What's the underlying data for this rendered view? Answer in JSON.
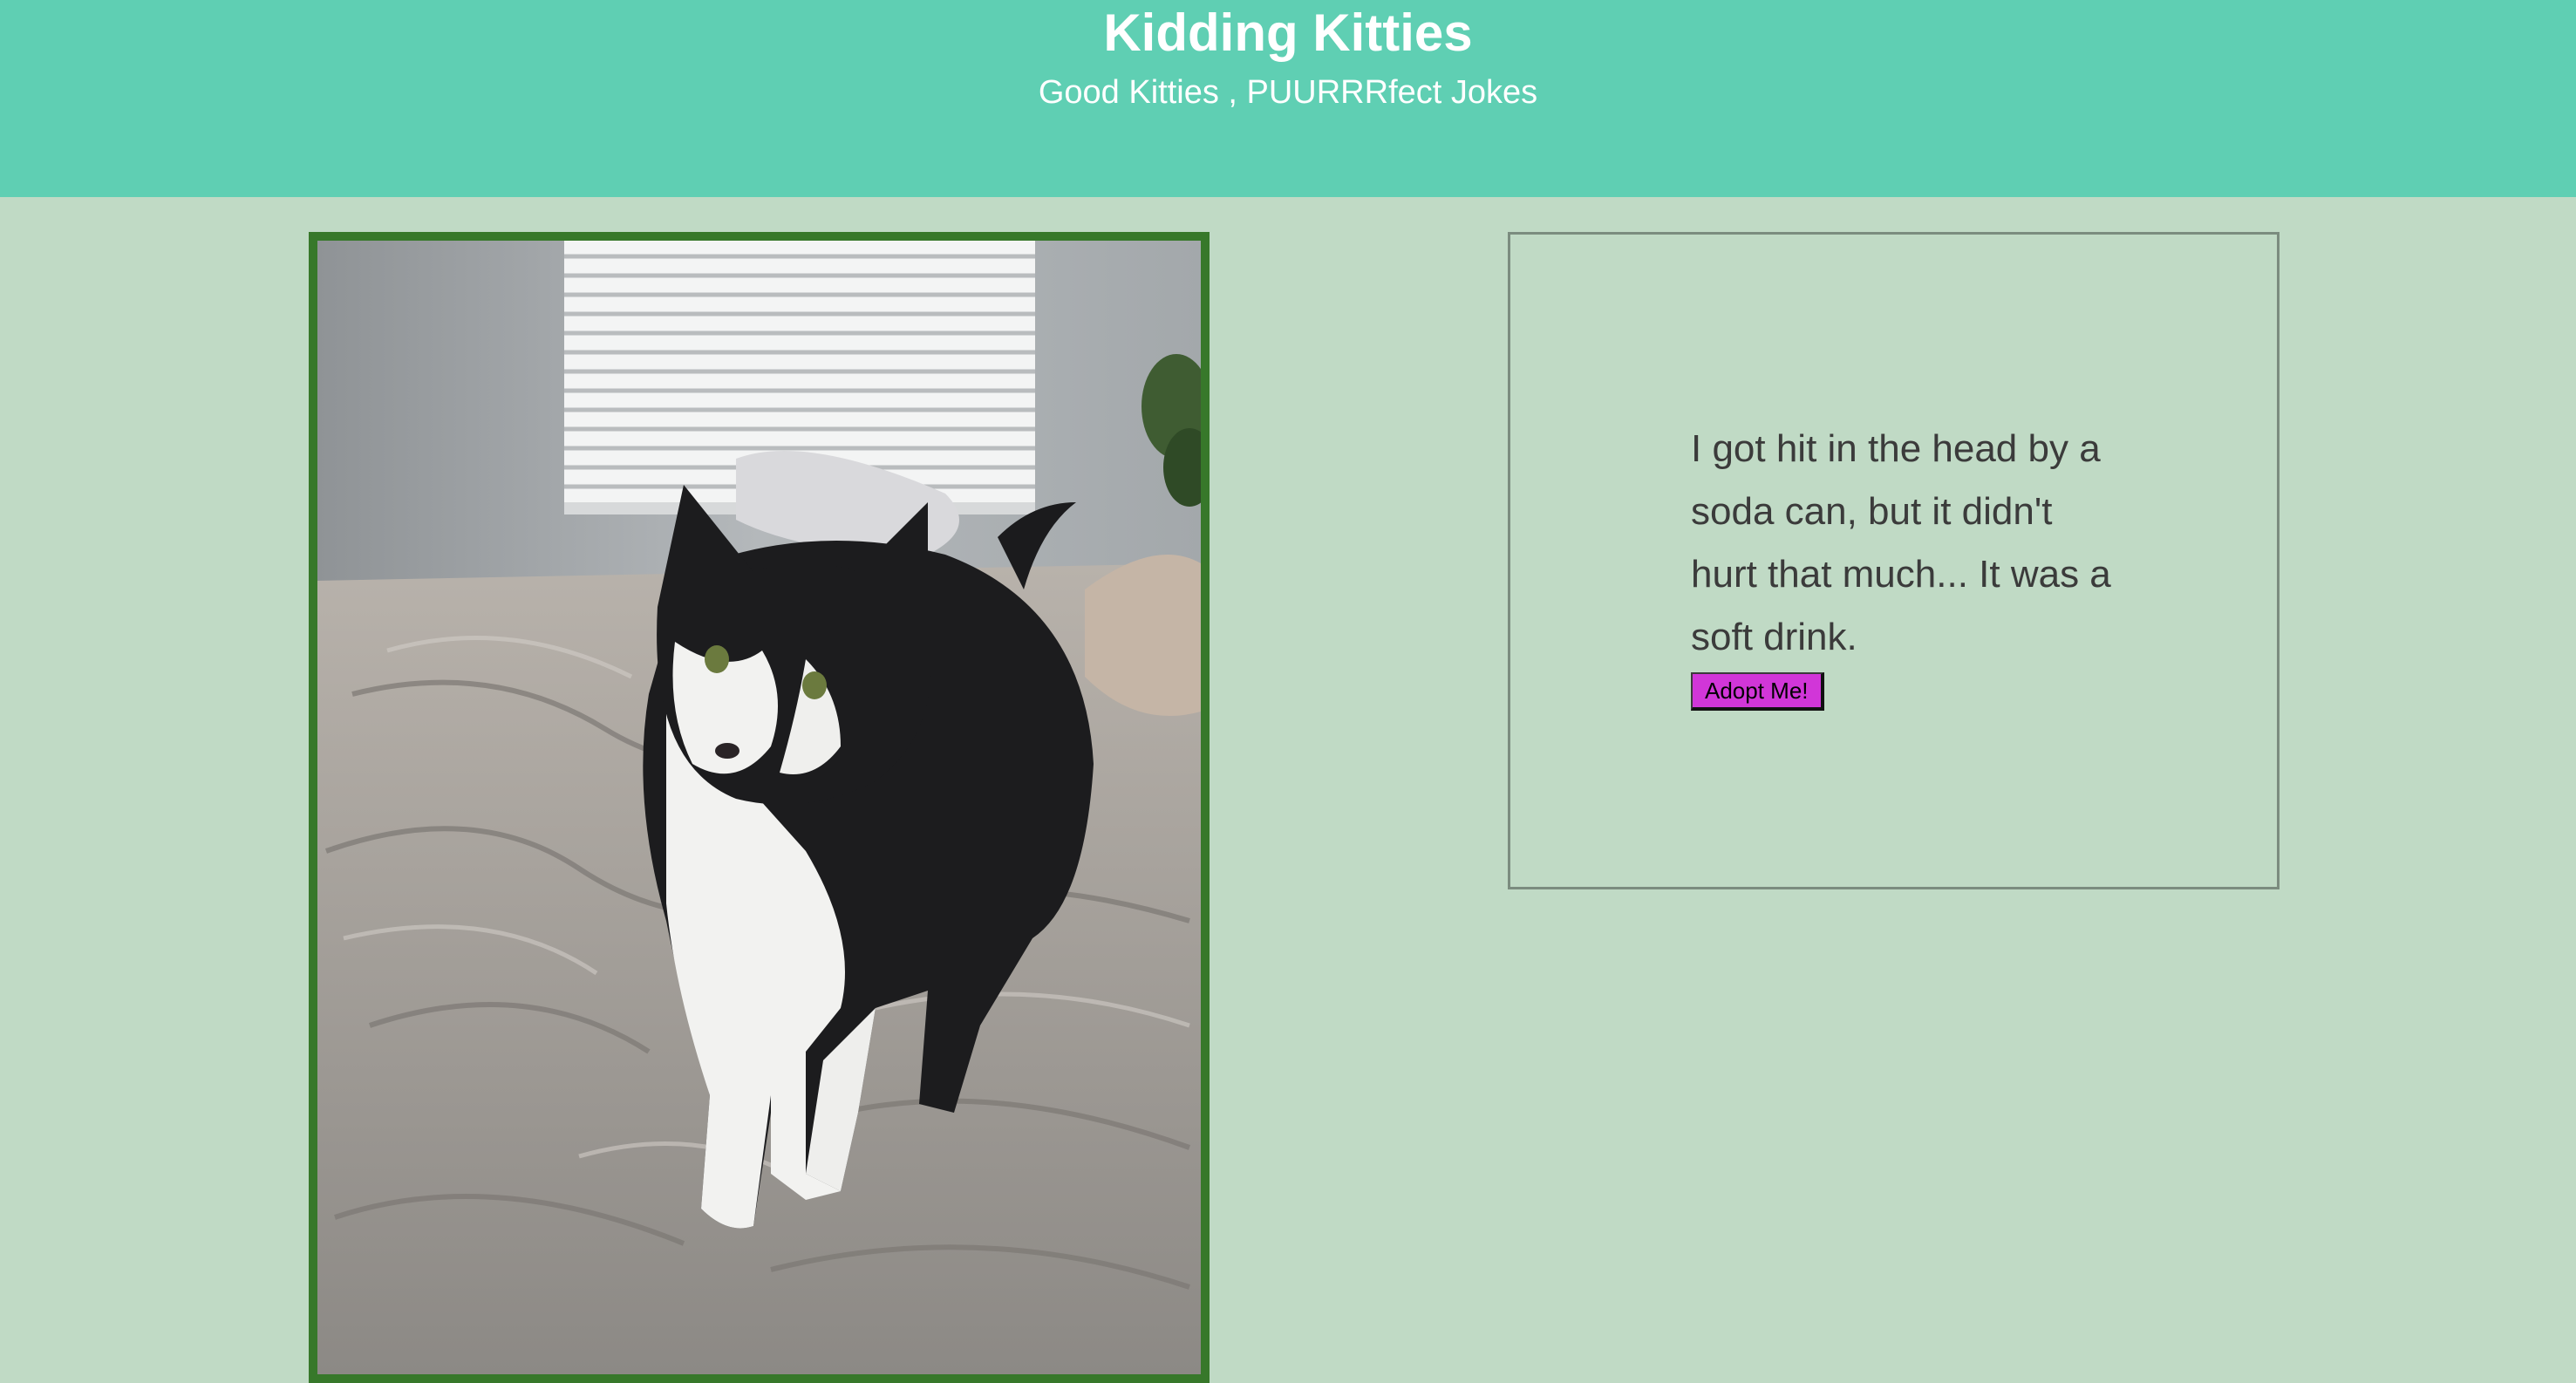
{
  "header": {
    "title": "Kidding Kitties",
    "subtitle": "Good Kitties , PUURRRfect Jokes"
  },
  "colors": {
    "header_bg": "#5fcfb3",
    "page_bg": "#c0dac5",
    "photo_border": "#37782a",
    "button_bg": "#d136d8"
  },
  "photo": {
    "subject": "black-and-white tuxedo cat standing on an unmade bed"
  },
  "joke": {
    "text": "I got hit in the head by a soda can, but it didn't hurt that much... It was a soft drink.",
    "button_label": "Adopt Me!"
  }
}
